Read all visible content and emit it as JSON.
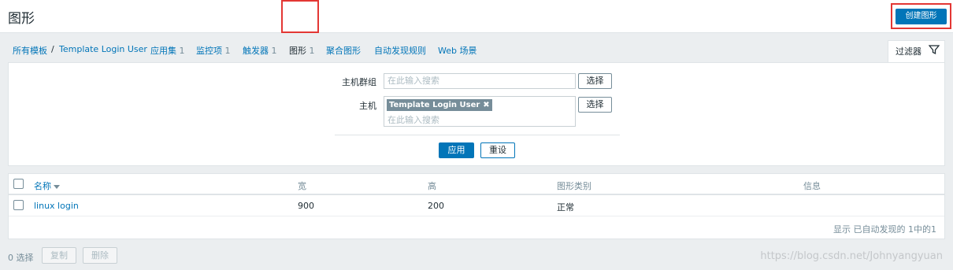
{
  "header": {
    "title": "图形",
    "create_button": "创建图形"
  },
  "nav": {
    "templates_link": "所有模板",
    "separator": "/",
    "host_link": "Template Login User",
    "tabs": [
      {
        "label": "应用集",
        "count": "1"
      },
      {
        "label": "监控项",
        "count": "1"
      },
      {
        "label": "触发器",
        "count": "1"
      },
      {
        "label": "图形",
        "count": "1"
      },
      {
        "label": "聚合图形",
        "count": ""
      },
      {
        "label": "自动发现规则",
        "count": ""
      },
      {
        "label": "Web 场景",
        "count": ""
      }
    ]
  },
  "filter": {
    "tab_label": "过滤器",
    "host_group_label": "主机群组",
    "host_group_placeholder": "在此输入搜索",
    "host_label": "主机",
    "host_chip": "Template Login User",
    "host_placeholder": "在此输入搜索",
    "select_label": "选择",
    "apply_label": "应用",
    "reset_label": "重设"
  },
  "table": {
    "columns": [
      "名称",
      "宽",
      "高",
      "图形类别",
      "信息"
    ],
    "rows": [
      {
        "name": "linux login",
        "width": "900",
        "height": "200",
        "type": "正常",
        "info": ""
      }
    ],
    "paging_info": "显示 已自动发现的 1中的1"
  },
  "footer": {
    "selected": "0 选择",
    "copy_label": "复制",
    "delete_label": "删除"
  },
  "watermark": "https://blog.csdn.net/Johnyangyuan",
  "colors": {
    "accent": "#0275b8",
    "highlight": "#e33734",
    "muted": "#768d99"
  }
}
